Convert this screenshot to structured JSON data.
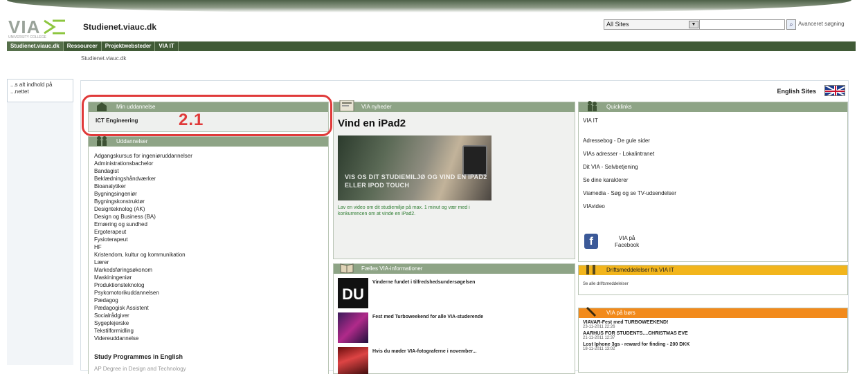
{
  "window": {
    "site_name": "Studienet.viauc.dk"
  },
  "logo": {
    "text": "VIA",
    "sub": "UNIVERSITY COLLEGE"
  },
  "search": {
    "scope": "All Sites",
    "value": "",
    "advanced_label": "Avanceret søgning"
  },
  "topnav": {
    "items": [
      "Studienet.viauc.dk",
      "Ressourcer",
      "Projektwebsteder",
      "VIA IT"
    ]
  },
  "breadcrumb": "Studienet.viauc.dk",
  "leftnav": {
    "text": "...s alt indhold på ...nettet"
  },
  "content": {
    "english_sites": "English Sites"
  },
  "annotation": {
    "label": "2.1",
    "color": "#e03a3a"
  },
  "min_uddannelse": {
    "title": "Min uddannelse",
    "value": "ICT Engineering"
  },
  "uddannelser": {
    "title": "Uddannelser",
    "items": [
      "Adgangskursus for ingeniøruddannelser",
      "Administrationsbachelor",
      "Bandagist",
      "Beklædningshåndværker",
      "Bioanalytiker",
      "Bygningsingeniør",
      "Bygningskonstruktør",
      "Designteknolog (AK)",
      "Design og Business (BA)",
      "Ernæring og sundhed",
      "Ergoterapeut",
      "Fysioterapeut",
      "HF",
      "Kristendom, kultur og kommunikation",
      "Lærer",
      "Markedsføringsøkonom",
      "Maskiningeniør",
      "Produktionsteknolog",
      "Psykomotorikuddannelsen",
      "Pædagog",
      "Pædagogisk Assistent",
      "Socialrådgiver",
      "Sygeplejerske",
      "Tekstilformidling",
      "Videreuddannelse"
    ],
    "english_heading": "Study Programmes in English",
    "english_first": "AP Degree in Design and Technology"
  },
  "via_nyheder": {
    "title": "VIA nyheder",
    "headline": "Vind en iPad2",
    "image_caption": "VIS OS DIT STUDIEMILJØ OG VIND EN IPAD2 ELLER IPOD TOUCH",
    "description": "Lav en video om dit studiemiljø på max. 1 minut og vær med i konkurrencen om at vinde en iPad2."
  },
  "faelles": {
    "title": "Fælles VIA-informationer",
    "items": [
      {
        "thumb": "DU",
        "text": "Vinderne fundet i tilfredshedsundersøgelsen"
      },
      {
        "thumb": "",
        "text": "Fest med Turboweekend for alle VIA-studerende"
      },
      {
        "thumb": "",
        "text": "Hvis du møder VIA-fotograferne i november..."
      }
    ]
  },
  "quicklinks": {
    "title": "Quicklinks",
    "links": [
      "VIA IT",
      "Adressebog - De gule sider",
      "VIAs adresser - Lokalintranet",
      "Dit VIA - Selvbetjening",
      "Se dine karakterer",
      "Viamedia - Søg og se TV-udsendelser",
      "VIAvideo"
    ],
    "facebook_label_line1": "VIA på",
    "facebook_label_line2": "Facebook"
  },
  "driftmeddelelser": {
    "title": "Driftsmeddelelser fra VIA IT",
    "body": "Se alle driftsmeddelelser"
  },
  "via_paa_boers": {
    "title": "VIA på børs",
    "items": [
      {
        "title": "VIAVAR-Fest med TURBOWEEKEND!",
        "date": "23-11-2011 22:26"
      },
      {
        "title": "AARHUS FOR STUDENTS....CHRISTMAS EVE",
        "date": "21-11-2011 12:37"
      },
      {
        "title": "Lost Iphone 3gs - reward for finding - 200 DKK",
        "date": "18-11-2011 13:02"
      }
    ]
  },
  "colors": {
    "nav_green": "#405a36",
    "panel_head_green": "#8ea486",
    "yellow": "#f2b51c",
    "orange": "#f28a1b",
    "facebook": "#3b5998"
  }
}
